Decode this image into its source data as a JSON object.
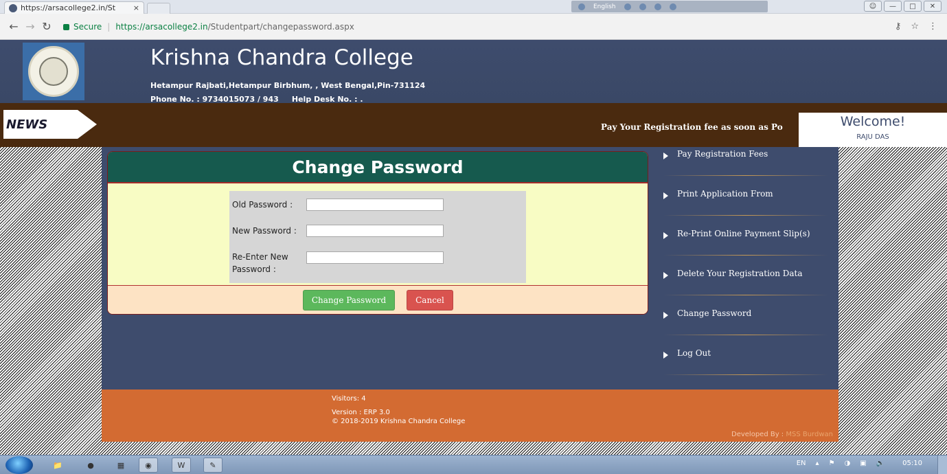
{
  "browser": {
    "tab_title": "https://arsacollege2.in/St",
    "tab_close": "×",
    "secure_label": "Secure",
    "url_host": "https://arsacollege2.in",
    "url_path": "/Studentpart/changepassword.aspx",
    "lang_label": "English"
  },
  "header": {
    "college_name": "Krishna Chandra College",
    "address": "Hetampur Rajbati,Hetampur Birbhum, , West Bengal,Pin-731124",
    "phone": "Phone No. : 9734015073 / 943     Help Desk No. : ."
  },
  "news": {
    "tag": "NEWS",
    "marquee": "Pay Your Registration fee as soon as Po"
  },
  "welcome": {
    "title": "Welcome!",
    "user": "RAJU DAS"
  },
  "change_password": {
    "title": "Change Password",
    "old_label": "Old Password :",
    "new_label": "New Password :",
    "reenter_label_line1": "Re-Enter New",
    "reenter_label_line2": "Password :",
    "old_value": "",
    "new_value": "",
    "reenter_value": "",
    "submit_label": "Change Password",
    "cancel_label": "Cancel"
  },
  "side_menu": {
    "items": [
      {
        "label": "Pay Registration Fees"
      },
      {
        "label": "Print Application From"
      },
      {
        "label": "Re-Print Online Payment Slip(s)"
      },
      {
        "label": "Delete Your Registration Data"
      },
      {
        "label": "Change Password"
      },
      {
        "label": "Log Out"
      }
    ]
  },
  "footer": {
    "visitors": "Visitors: 4",
    "version": "Version : ERP 3.0",
    "copyright": "© 2018-2019   Krishna Chandra College",
    "developed_by": "Developed By : ",
    "developer": "MSS Burdwan"
  },
  "taskbar": {
    "lang": "EN",
    "clock": "05:10"
  },
  "colors": {
    "header_bg": "#3e4c6d",
    "news_bg": "#4a2a0f",
    "panel_title_bg": "#165a4e",
    "footer_bg": "#d36b32",
    "btn_green": "#5cb85c",
    "btn_red": "#d9534f"
  }
}
